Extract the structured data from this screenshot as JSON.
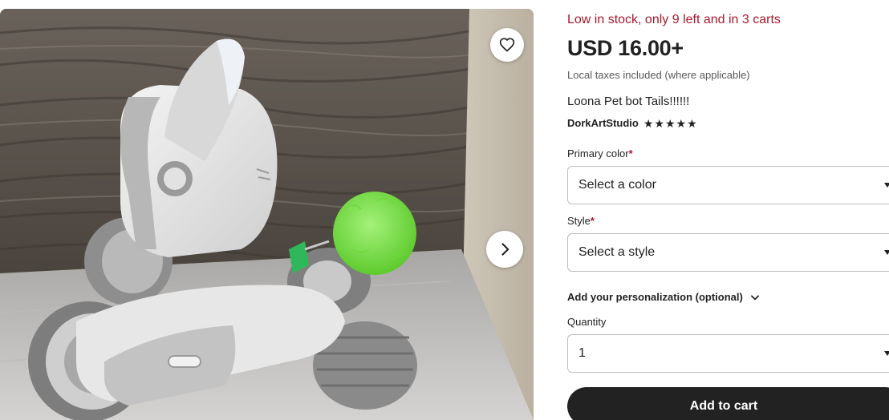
{
  "listing": {
    "stock_notice": "Low in stock, only 9 left and in 3 carts",
    "price": "USD 16.00+",
    "tax_note": "Local taxes included (where applicable)",
    "title": "Loona Pet bot Tails!!!!!!",
    "shop_name": "DorkArtStudio",
    "rating_stars": 5
  },
  "options": {
    "primary_color": {
      "label": "Primary color",
      "required_mark": "*",
      "value": "Select a color"
    },
    "style": {
      "label": "Style",
      "required_mark": "*",
      "value": "Select a style"
    },
    "personalization_label": "Add your personalization (optional)",
    "quantity": {
      "label": "Quantity",
      "value": "1"
    }
  },
  "actions": {
    "add_to_cart": "Add to cart"
  },
  "icons": {
    "favorite": "heart-outline-icon",
    "next": "chevron-right-icon",
    "expand": "chevron-down-icon",
    "star": "star-icon"
  },
  "colors": {
    "stock_text": "#a61a2e",
    "primary_button": "#222222",
    "required_mark": "#a61a2e",
    "pompom": "#7ee04a"
  }
}
